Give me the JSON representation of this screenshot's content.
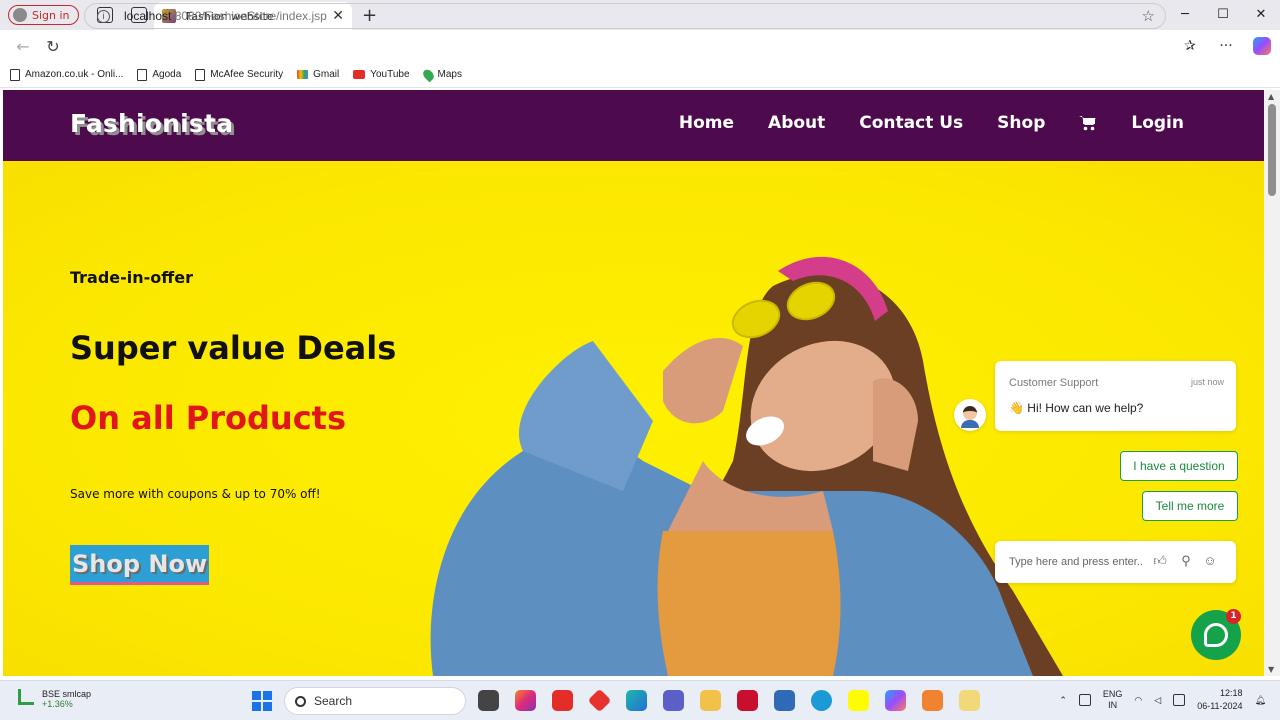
{
  "browser": {
    "signin_label": "Sign in",
    "tab_title": "Fashion website",
    "url_host": "localhost",
    "url_rest": ":8080/FashionStore/index.jsp",
    "bookmarks": [
      "Amazon.co.uk - Onli...",
      "Agoda",
      "McAfee Security",
      "Gmail",
      "YouTube",
      "Maps"
    ]
  },
  "site": {
    "brand": "Fashionista",
    "nav": [
      "Home",
      "About",
      "Contact Us",
      "Shop",
      "Login"
    ]
  },
  "hero": {
    "kicker": "Trade-in-offer",
    "headline": "Super value Deals",
    "headline_accent": "On all Products",
    "subtext": "Save more with coupons & up to 70% off!",
    "cta": "Shop Now"
  },
  "chat": {
    "agent_name": "Customer Support",
    "timestamp": "just now",
    "message": "👋 Hi! How can we help?",
    "quick_replies": [
      "I have a question",
      "Tell me more"
    ],
    "input_placeholder": "Type here and press enter..",
    "unread_count": "1"
  },
  "taskbar": {
    "ticker_name": "BSE smlcap",
    "ticker_change": "+1.36%",
    "search_placeholder": "Search",
    "lang_line1": "ENG",
    "lang_line2": "IN",
    "time": "12:18",
    "date": "06-11-2024"
  },
  "colors": {
    "nav_bg": "#4d0a4d",
    "hero_bg": "#fbe700",
    "accent_red": "#e0161b",
    "cta_bg": "#2d9fd4",
    "chat_green": "#14a24a"
  }
}
